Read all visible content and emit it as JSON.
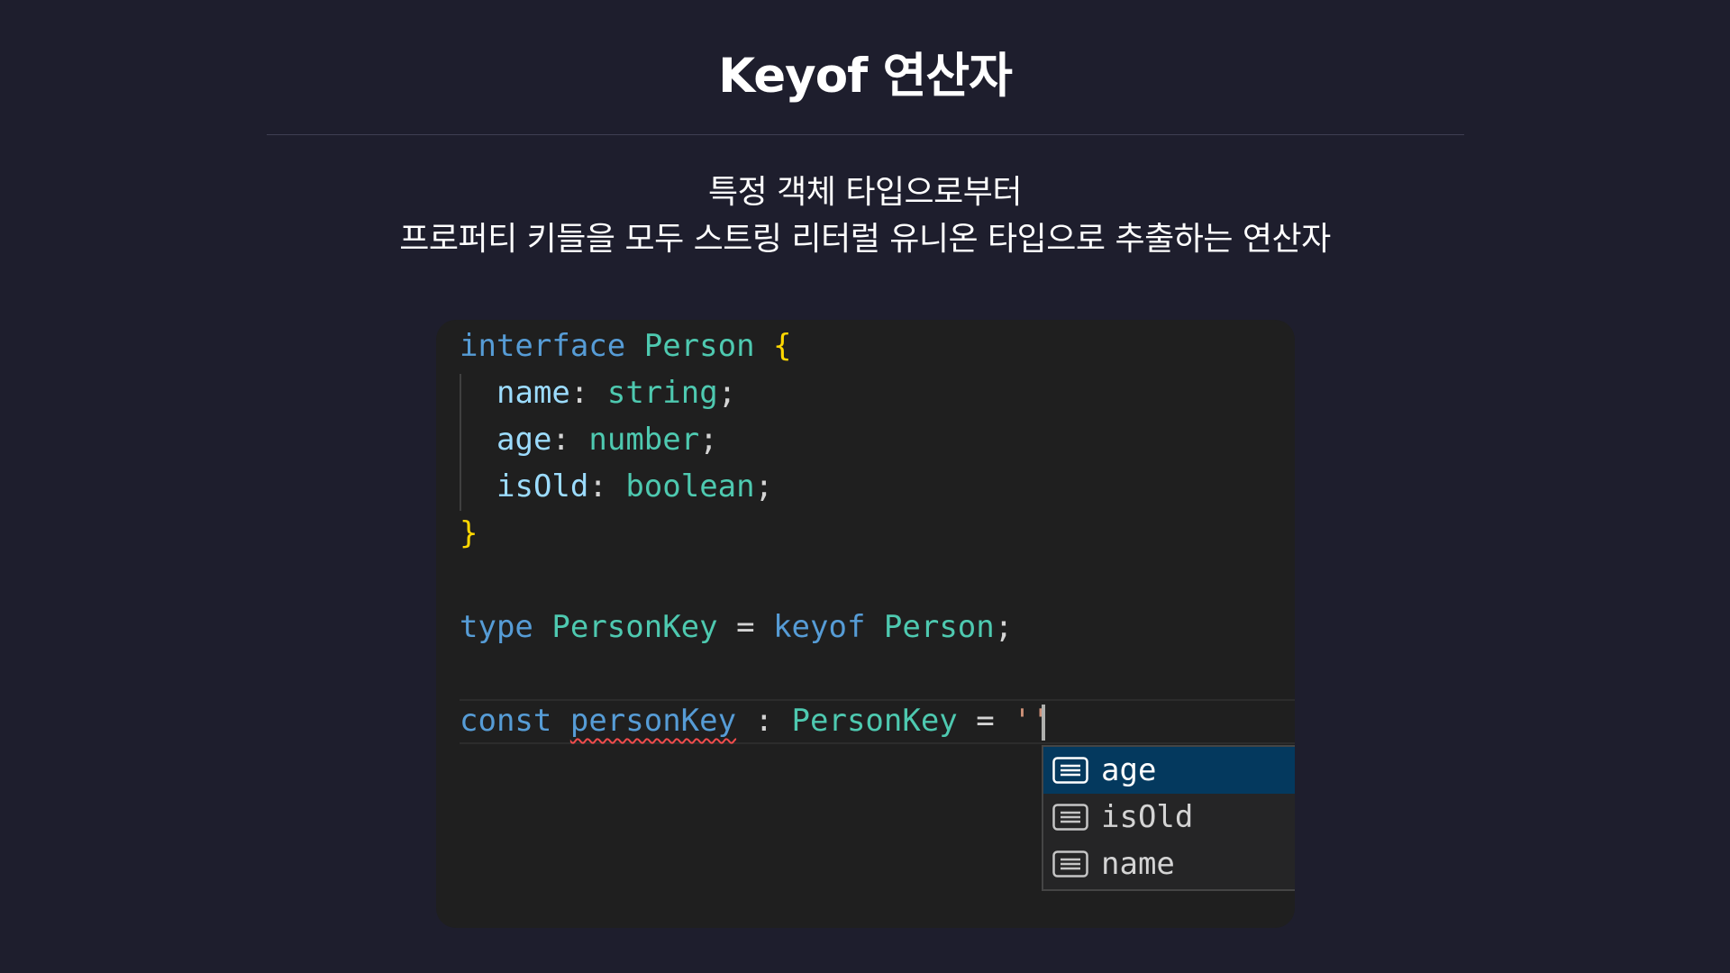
{
  "slide": {
    "title": "Keyof 연산자",
    "subtitle_line1": "특정 객체 타입으로부터",
    "subtitle_line2": "프로퍼티 키들을 모두 스트링 리터럴 유니온 타입으로 추출하는 연산자"
  },
  "code": {
    "line1": {
      "kw": "interface",
      "type": "Person",
      "brace": "{"
    },
    "line2": {
      "prop": "name",
      "colon": ":",
      "type": "string",
      "semi": ";"
    },
    "line3": {
      "prop": "age",
      "colon": ":",
      "type": "number",
      "semi": ";"
    },
    "line4": {
      "prop": "isOld",
      "colon": ":",
      "type": "boolean",
      "semi": ";"
    },
    "line5": {
      "brace": "}"
    },
    "line7": {
      "kw": "type",
      "name": "PersonKey",
      "eq": "=",
      "op": "keyof",
      "target": "Person",
      "semi": ";"
    },
    "line9": {
      "kw": "const",
      "var": "personKey",
      "colon": ":",
      "type": "PersonKey",
      "eq": "=",
      "quote": "'",
      "quote_close": "'"
    }
  },
  "suggestions": {
    "icon": "field-icon",
    "items": [
      {
        "label": "age",
        "selected": true
      },
      {
        "label": "isOld",
        "selected": false
      },
      {
        "label": "name",
        "selected": false
      }
    ]
  },
  "colors": {
    "background": "#1e1e2d",
    "editor_bg": "#1f1f1f",
    "keyword": "#569cd6",
    "type": "#4ec9b0",
    "bracket": "#ffd700",
    "property": "#9cdcfe",
    "selection": "#04395e"
  }
}
